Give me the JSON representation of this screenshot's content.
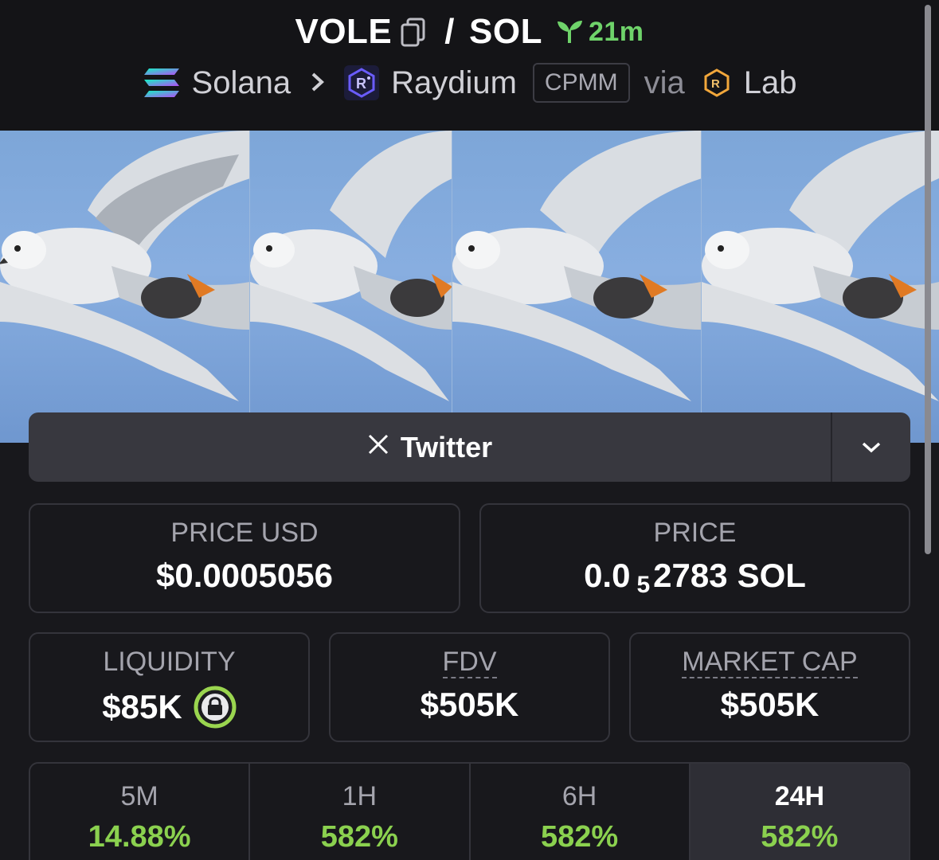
{
  "header": {
    "token": "VOLE",
    "slash": "/",
    "quote": "SOL",
    "age": "21m",
    "chain": "Solana",
    "dex": "Raydium",
    "pool_type": "CPMM",
    "via": "via",
    "launchpad": "Lab"
  },
  "twitter": {
    "label": "Twitter",
    "icon": "x-icon"
  },
  "stats": {
    "price_usd": {
      "label": "PRICE USD",
      "value": "$0.0005056"
    },
    "price": {
      "label": "PRICE",
      "prefix": "0.0",
      "subscript": "5",
      "digits": "2783",
      "unit": "SOL"
    },
    "liquidity": {
      "label": "LIQUIDITY",
      "value": "$85K"
    },
    "fdv": {
      "label": "FDV",
      "value": "$505K"
    },
    "market_cap": {
      "label": "MARKET CAP",
      "value": "$505K"
    }
  },
  "changes": [
    {
      "period": "5M",
      "value": "14.88%"
    },
    {
      "period": "1H",
      "value": "582%"
    },
    {
      "period": "6H",
      "value": "582%"
    },
    {
      "period": "24H",
      "value": "582%"
    }
  ],
  "colors": {
    "accent_green": "#8bd14f",
    "age_green": "#6fd36a",
    "background": "#18181c"
  }
}
